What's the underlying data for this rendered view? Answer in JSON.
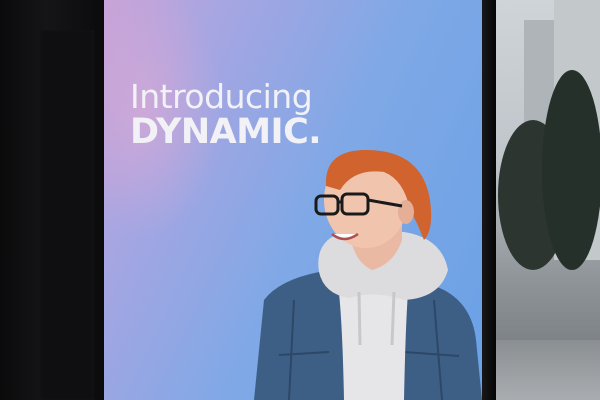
{
  "poster": {
    "headline_line1": "Introducing",
    "headline_line2": "DYNAMIC."
  },
  "colors": {
    "poster_gradient_start": "#c8a3d8",
    "poster_gradient_end": "#6aa1e6",
    "headline_text": "#f2f2f6",
    "hair": "#d0632e",
    "jacket": "#3d5f86",
    "hoodie": "#e6e6e8"
  }
}
